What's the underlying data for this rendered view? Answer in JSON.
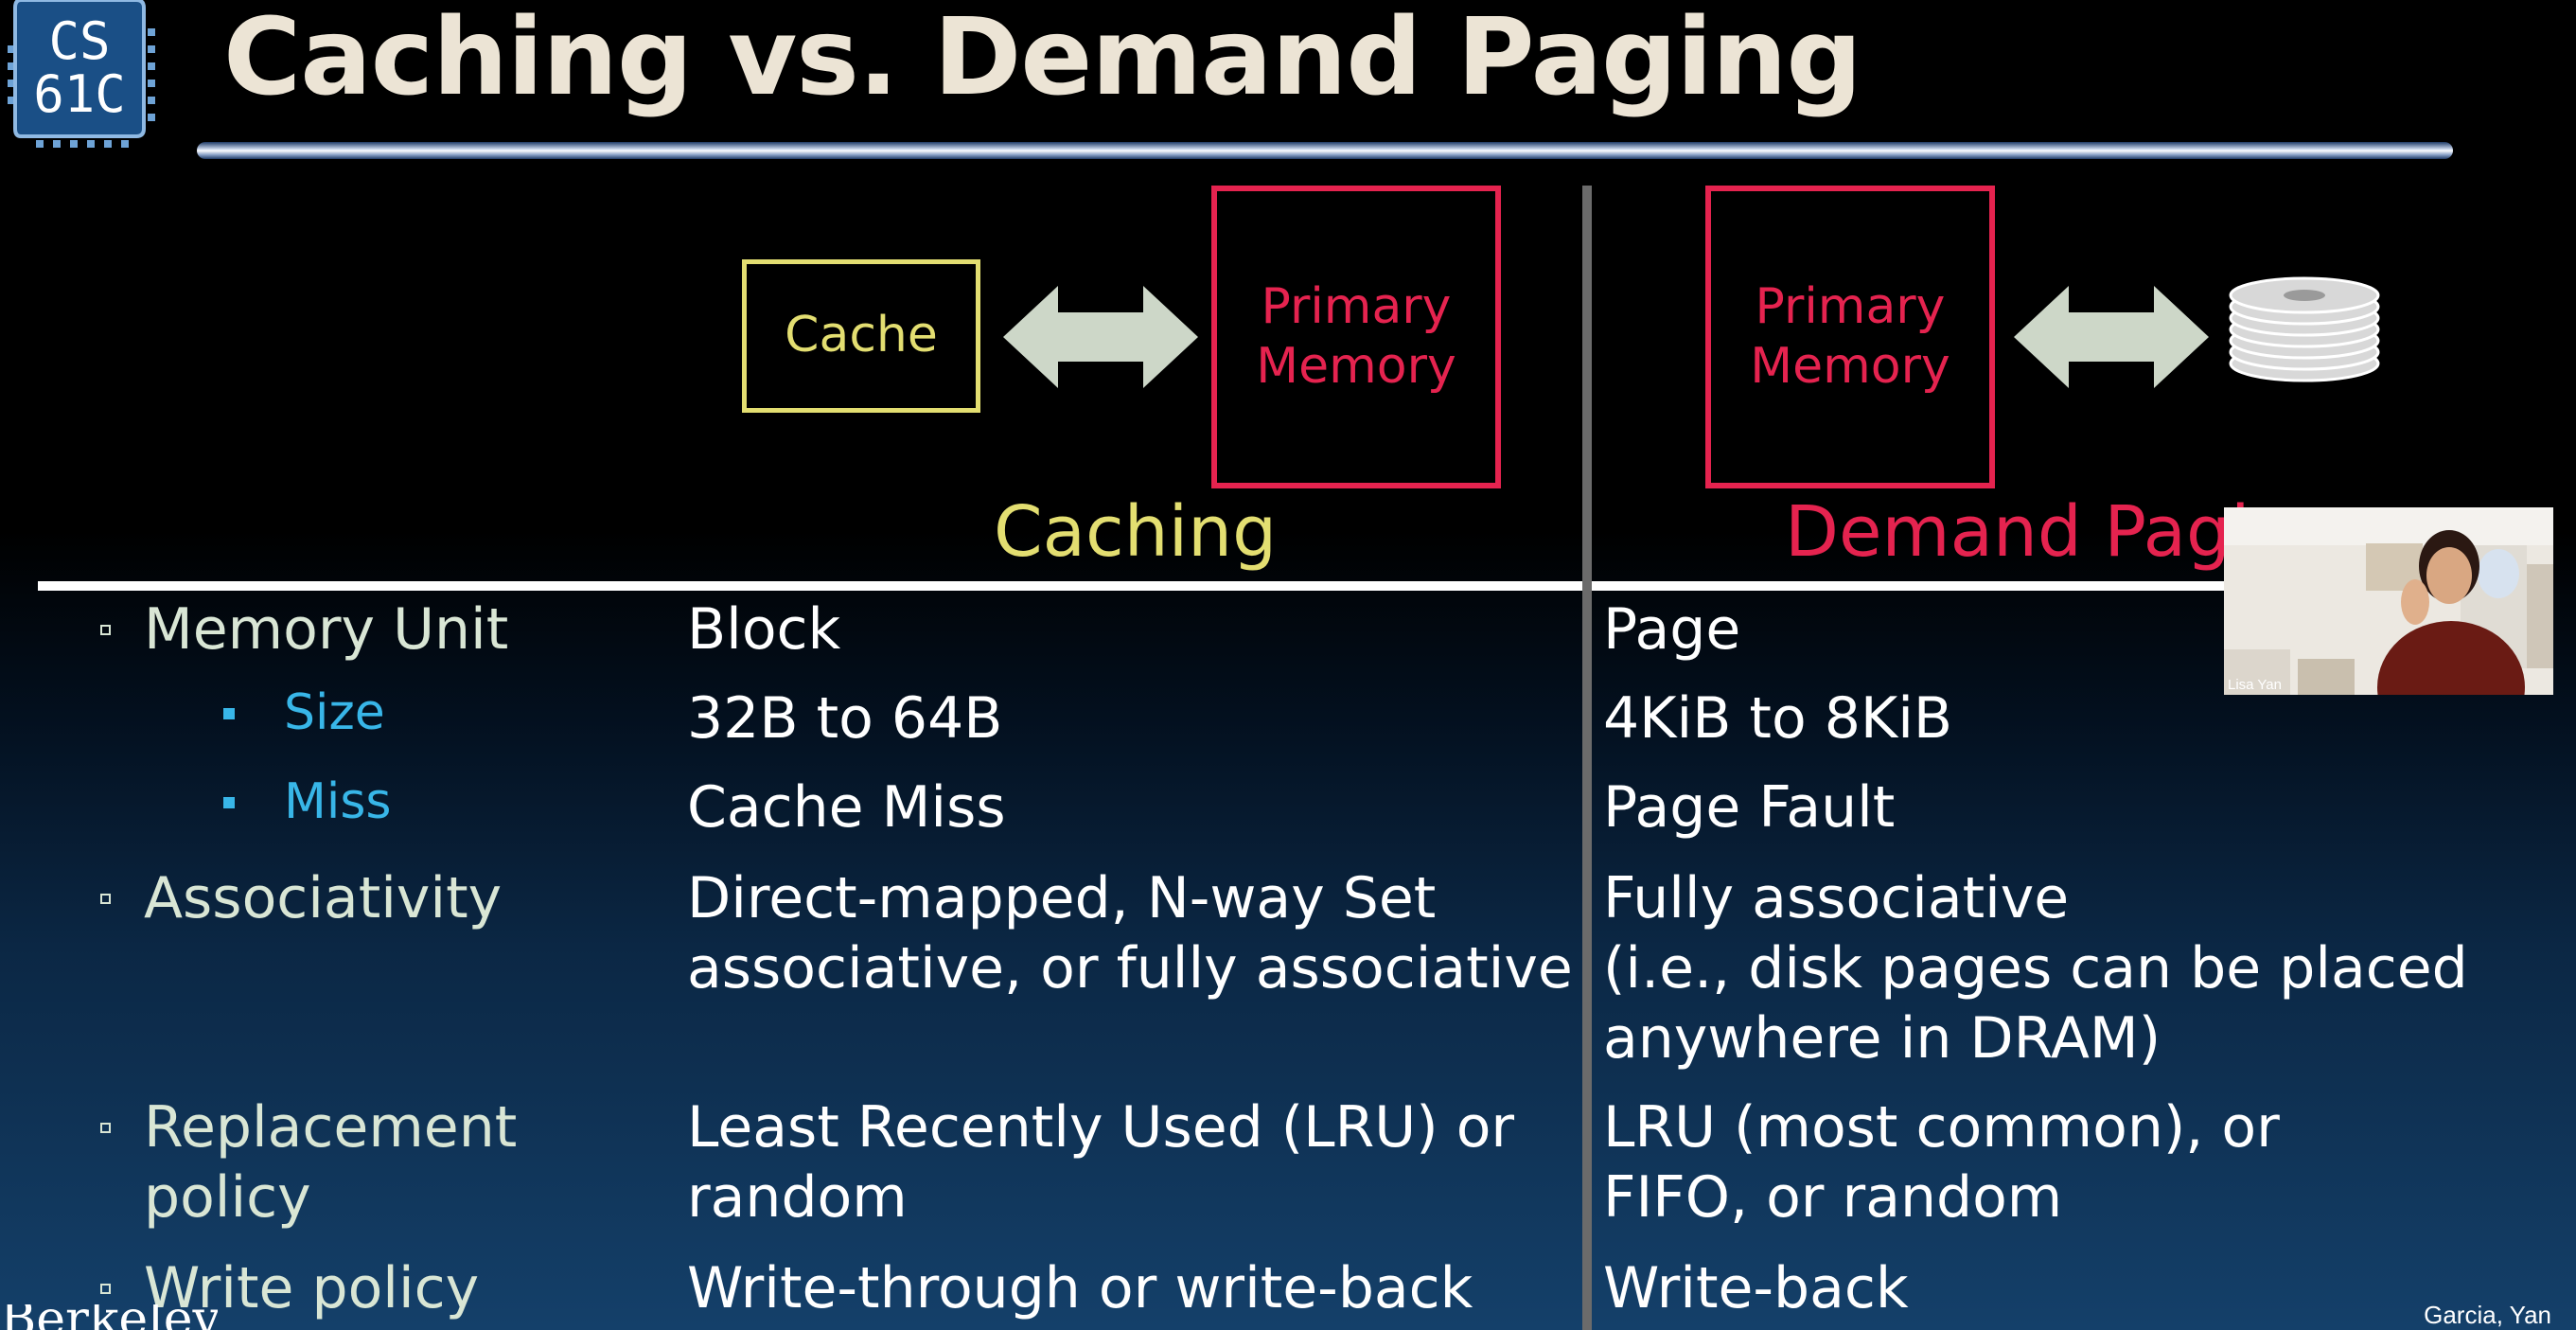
{
  "logo": {
    "line1": "CS",
    "line2": "61C",
    "colors": {
      "chip": "#1a4f86",
      "text": "#ffffff",
      "pins": "#6ea3d6"
    }
  },
  "slide": {
    "title": "Caching vs. Demand Paging"
  },
  "diagram": {
    "cache_box": "Cache",
    "primary_memory_1": {
      "line1": "Primary",
      "line2": "Memory"
    },
    "primary_memory_2": {
      "line1": "Primary",
      "line2": "Memory"
    },
    "caching_label": "Caching",
    "demand_paging_label": "Demand Pagi",
    "icons": [
      "double-arrow-icon",
      "disk-stack-icon"
    ]
  },
  "table": {
    "rows": [
      {
        "label": "Memory Unit",
        "caching": [
          "Block"
        ],
        "paging": [
          "Page"
        ]
      },
      {
        "label": "Size",
        "caching": [
          "32B to 64B"
        ],
        "paging": [
          "4KiB to 8KiB"
        ]
      },
      {
        "label": "Miss",
        "caching": [
          "Cache Miss"
        ],
        "paging": [
          "Page Fault"
        ]
      },
      {
        "label": "Associativity",
        "caching": [
          "Direct-mapped, N-way Set",
          "associative, or fully associative"
        ],
        "paging": [
          "Fully associative",
          "(i.e., disk pages can be placed",
          "anywhere in DRAM)"
        ]
      },
      {
        "label": [
          "Replacement",
          "policy"
        ],
        "caching": [
          "Least Recently Used (LRU) or",
          "random"
        ],
        "paging": [
          "LRU (most common), or",
          "FIFO, or random"
        ]
      },
      {
        "label": "Write policy",
        "caching": [
          "Write-through or write-back"
        ],
        "paging": [
          "Write-back"
        ]
      }
    ]
  },
  "webcam": {
    "name": "Lisa Yan"
  },
  "footer": {
    "credit": "Garcia, Yan",
    "berkeley": "Berkeley"
  },
  "colors": {
    "yellow": "#e3de71",
    "red": "#e5234f",
    "blue_sub": "#38b6e8",
    "label": "#d9e6d5",
    "title": "#ece4d5",
    "arrow": "#cdd7c8"
  }
}
